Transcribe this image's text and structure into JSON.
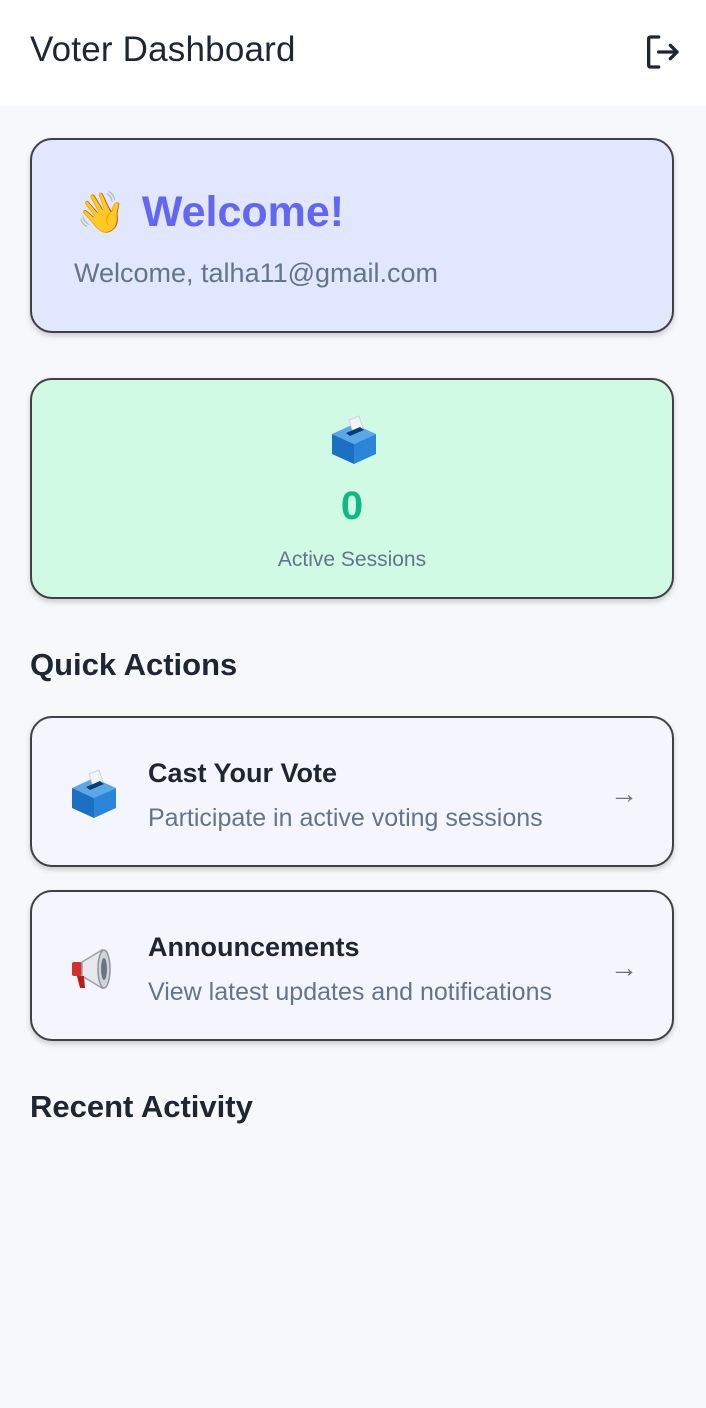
{
  "appbar": {
    "title": "Voter Dashboard",
    "logout_icon": "logout-icon"
  },
  "welcome": {
    "emoji": "👋",
    "title": "Welcome!",
    "subtitle": "Welcome, talha11@gmail.com"
  },
  "stats": {
    "icon": "ballot-box-icon",
    "count": "0",
    "label": "Active Sessions"
  },
  "quick_actions": {
    "title": "Quick Actions",
    "items": [
      {
        "icon": "ballot-box-icon",
        "title": "Cast Your Vote",
        "description": "Participate in active voting sessions",
        "arrow": "→"
      },
      {
        "icon": "megaphone-icon",
        "title": "Announcements",
        "description": "View latest updates and notifications",
        "arrow": "→"
      }
    ]
  },
  "recent_activity": {
    "title": "Recent Activity"
  },
  "colors": {
    "accent": "#6366f1",
    "success": "#10b981",
    "welcome_bg": "#e0e7ff",
    "stats_bg": "#d1fae5"
  }
}
